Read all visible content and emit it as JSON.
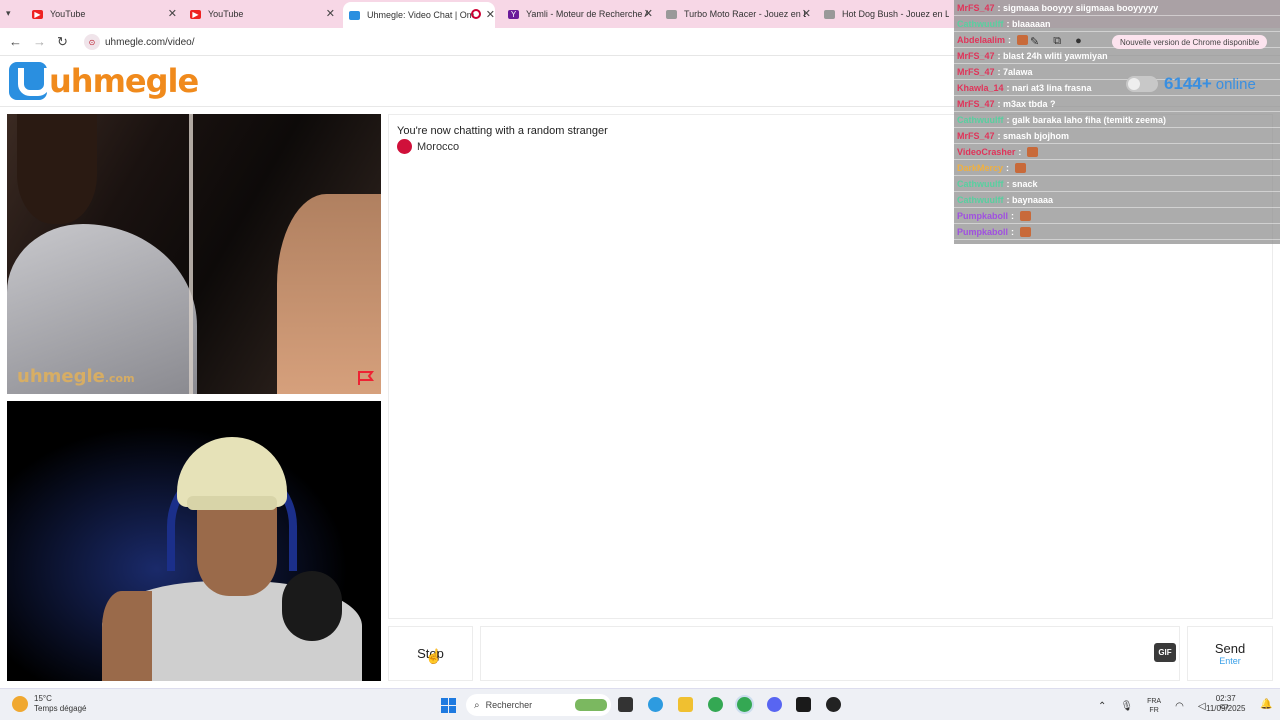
{
  "browser": {
    "tabs": [
      {
        "label": "YouTube",
        "favicon": "youtube-icon",
        "color": "#e22"
      },
      {
        "label": "YouTube",
        "favicon": "youtube-icon",
        "color": "#e22"
      },
      {
        "label": "Uhmegle: Video Chat | Om",
        "favicon": "uhmegle-icon",
        "color": "#2a8fe0",
        "active": true
      },
      {
        "label": "Yamli - Moteur de Recherche A",
        "favicon": "yamli-icon",
        "color": "#6a1b9a"
      },
      {
        "label": "Turbo Moto Racer - Jouez en L",
        "favicon": "game-icon",
        "color": "#888"
      },
      {
        "label": "Hot Dog Bush - Jouez en Ligne",
        "favicon": "game-icon",
        "color": "#888"
      }
    ],
    "url": "uhmegle.com/video/",
    "update_notice": "Nouvelle version de Chrome disponible"
  },
  "site": {
    "logo_text": "uhmegle",
    "watermark": "uhmegle",
    "watermark_suffix": ".com"
  },
  "chat": {
    "status": "You're now chatting with a random stranger",
    "country": "Morocco",
    "input_placeholder": "",
    "stop_label": "Stop",
    "send_label": "Send",
    "send_hint": "Enter",
    "gif_label": "GIF"
  },
  "online": {
    "count": "6144+",
    "label": "online"
  },
  "overlay_messages": [
    {
      "user": "MrFS_47",
      "text": "sigmaaa booyyy siigmaaa booyyyyy",
      "color": "#e0345a"
    },
    {
      "user": "Cathwuulff",
      "text": "blaaaaan",
      "color": "#58d0a0"
    },
    {
      "user": "Abdelaalim",
      "text": "",
      "color": "#e0345a"
    },
    {
      "user": "MrFS_47",
      "text": "blast 24h wliti yawmiyan",
      "color": "#e0345a"
    },
    {
      "user": "MrFS_47",
      "text": "7alawa",
      "color": "#e0345a"
    },
    {
      "user": "Khawla_14",
      "text": "nari at3 lina frasna",
      "color": "#e0345a"
    },
    {
      "user": "MrFS_47",
      "text": "m3ax tbda ?",
      "color": "#e0345a"
    },
    {
      "user": "Cathwuulff",
      "text": "galk baraka laho fiha (temitk zeema)",
      "color": "#58d0a0"
    },
    {
      "user": "MrFS_47",
      "text": "smash bjojhom",
      "color": "#e0345a"
    },
    {
      "user": "VideoCrasher",
      "text": "",
      "color": "#e0345a"
    },
    {
      "user": "DarkMercy",
      "text": "",
      "color": "#f0b040"
    },
    {
      "user": "Cathwuulff",
      "text": "snack",
      "color": "#58d0a0"
    },
    {
      "user": "Cathwuulff",
      "text": "baynaaaa",
      "color": "#58d0a0"
    },
    {
      "user": "Pumpkaboll",
      "text": "",
      "color": "#a050e0"
    },
    {
      "user": "Pumpkaboll",
      "text": "",
      "color": "#a050e0"
    }
  ],
  "taskbar": {
    "temperature": "15°C",
    "weather": "Temps dégagé",
    "search_placeholder": "Rechercher",
    "lang_top": "FRA",
    "lang_bottom": "FR",
    "time": "02:37",
    "date": "11/09/2025"
  }
}
